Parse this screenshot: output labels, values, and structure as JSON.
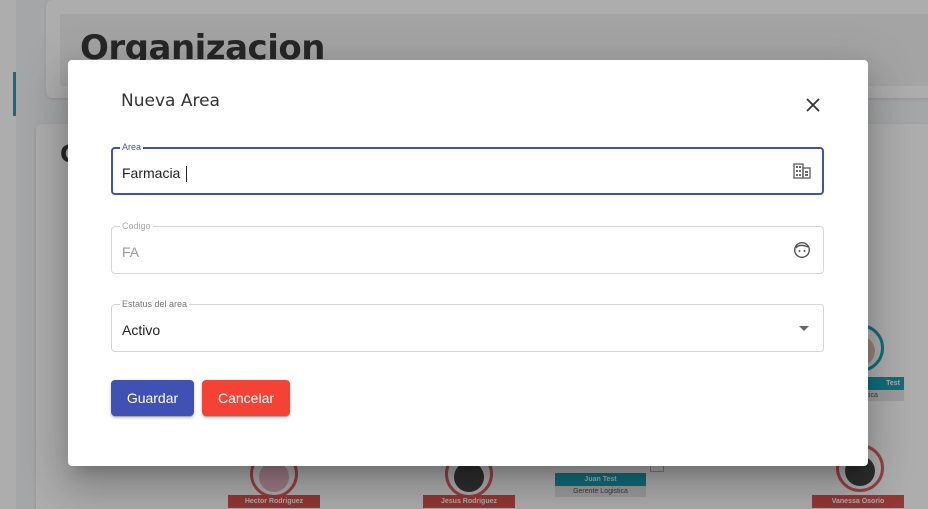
{
  "background": {
    "page_title": "Organizacion",
    "section_title_initial": "C",
    "org_nodes": [
      {
        "name": "Hector Rodriguez",
        "name_color": "red"
      },
      {
        "name": "Jesus Rodriguez",
        "name_color": "red"
      },
      {
        "name": "Juan Test",
        "role": "Gerente Logistica",
        "name_color": "teal"
      },
      {
        "name": "Vanessa Osorio",
        "name_color": "red"
      },
      {
        "name": "Test",
        "role": "istica",
        "name_color": "teal"
      }
    ]
  },
  "dialog": {
    "title": "Nueva Area",
    "close_icon": "close-icon",
    "fields": {
      "area": {
        "label": "Area",
        "value": "Farmacia",
        "icon": "building-icon"
      },
      "codigo": {
        "label": "Codigo",
        "value": "FA",
        "icon": "face-icon",
        "disabled": true
      },
      "estatus": {
        "label": "Estatus del area",
        "value": "Activo",
        "icon": "dropdown-arrow-icon"
      }
    },
    "buttons": {
      "save": "Guardar",
      "cancel": "Cancelar"
    }
  },
  "colors": {
    "primary": "#3f51b5",
    "danger": "#f44336",
    "teal": "#17a2b8",
    "node_red": "#d9534f"
  }
}
